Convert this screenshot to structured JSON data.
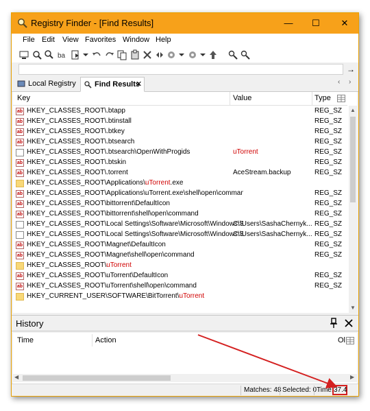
{
  "window": {
    "title": "Registry Finder - [Find Results]",
    "buttons": {
      "minimize": "—",
      "maximize": "☐",
      "close": "✕"
    }
  },
  "menu": [
    "File",
    "Edit",
    "View",
    "Favorites",
    "Window",
    "Help"
  ],
  "tabs": [
    {
      "label": "Local Registry",
      "active": false
    },
    {
      "label": "Find Results",
      "active": true,
      "close": "✕"
    }
  ],
  "results": {
    "columns": {
      "key": "Key",
      "value": "Value",
      "type": "Type"
    },
    "rows": [
      {
        "icon": "ab",
        "key": "HKEY_CLASSES_ROOT\\.btapp",
        "key_hl": "",
        "value": "",
        "value_hl": "",
        "type": "REG_SZ"
      },
      {
        "icon": "ab",
        "key": "HKEY_CLASSES_ROOT\\.btinstall",
        "key_hl": "",
        "value": "",
        "value_hl": "",
        "type": "REG_SZ"
      },
      {
        "icon": "ab",
        "key": "HKEY_CLASSES_ROOT\\.btkey",
        "key_hl": "",
        "value": "",
        "value_hl": "",
        "type": "REG_SZ"
      },
      {
        "icon": "ab",
        "key": "HKEY_CLASSES_ROOT\\.btsearch",
        "key_hl": "",
        "value": "",
        "value_hl": "",
        "type": "REG_SZ"
      },
      {
        "icon": "doc",
        "key": "HKEY_CLASSES_ROOT\\.btsearch\\OpenWithProgids",
        "key_hl": "",
        "value": "",
        "value_hl": "uTorrent",
        "type": "REG_SZ"
      },
      {
        "icon": "ab",
        "key": "HKEY_CLASSES_ROOT\\.btskin",
        "key_hl": "",
        "value": "",
        "value_hl": "",
        "type": "REG_SZ"
      },
      {
        "icon": "ab",
        "key": "HKEY_CLASSES_ROOT\\.torrent",
        "key_hl": "",
        "value": "AceStream.backup",
        "value_hl": "",
        "type": "REG_SZ"
      },
      {
        "icon": "folder",
        "key": "HKEY_CLASSES_ROOT\\Applications\\",
        "key_hl": "uTorrent",
        "key_tail": ".exe",
        "value": "",
        "value_hl": "",
        "type": ""
      },
      {
        "icon": "ab",
        "key": "HKEY_CLASSES_ROOT\\Applications\\uTorrent.exe\\shell\\open\\command...",
        "key_hl": "",
        "value": "",
        "value_hl": "",
        "type": "REG_SZ"
      },
      {
        "icon": "ab",
        "key": "HKEY_CLASSES_ROOT\\bittorrent\\DefaultIcon",
        "key_hl": "",
        "value": "",
        "value_hl": "",
        "type": "REG_SZ"
      },
      {
        "icon": "ab",
        "key": "HKEY_CLASSES_ROOT\\bittorrent\\shell\\open\\command",
        "key_hl": "",
        "value": "",
        "value_hl": "",
        "type": "REG_SZ"
      },
      {
        "icon": "doc",
        "key": "HKEY_CLASSES_ROOT\\Local Settings\\Software\\Microsoft\\Windows\\S...",
        "key_hl": "",
        "value": "C:\\Users\\SashaChernyk...",
        "value_hl": "",
        "type": "REG_SZ"
      },
      {
        "icon": "doc",
        "key": "HKEY_CLASSES_ROOT\\Local Settings\\Software\\Microsoft\\Windows\\S...",
        "key_hl": "",
        "value": "C:\\Users\\SashaChernyk...",
        "value_hl": "",
        "type": "REG_SZ"
      },
      {
        "icon": "ab",
        "key": "HKEY_CLASSES_ROOT\\Magnet\\DefaultIcon",
        "key_hl": "",
        "value": "",
        "value_hl": "",
        "type": "REG_SZ"
      },
      {
        "icon": "ab",
        "key": "HKEY_CLASSES_ROOT\\Magnet\\shell\\open\\command",
        "key_hl": "",
        "value": "",
        "value_hl": "",
        "type": "REG_SZ"
      },
      {
        "icon": "folder",
        "key": "HKEY_CLASSES_ROOT\\",
        "key_hl": "uTorrent",
        "key_tail": "",
        "value": "",
        "value_hl": "",
        "type": ""
      },
      {
        "icon": "ab",
        "key": "HKEY_CLASSES_ROOT\\uTorrent\\DefaultIcon",
        "key_hl": "",
        "value": "",
        "value_hl": "",
        "type": "REG_SZ"
      },
      {
        "icon": "ab",
        "key": "HKEY_CLASSES_ROOT\\uTorrent\\shell\\open\\command",
        "key_hl": "",
        "value": "",
        "value_hl": "",
        "type": "REG_SZ"
      },
      {
        "icon": "folder",
        "key": "HKEY_CURRENT_USER\\SOFTWARE\\BitTorrent\\",
        "key_hl": "uTorrent",
        "key_tail": "",
        "value": "",
        "value_hl": "",
        "type": ""
      }
    ]
  },
  "history": {
    "title": "History",
    "columns": {
      "time": "Time",
      "action": "Action",
      "ol": "Ol"
    }
  },
  "status": {
    "matches": "Matches: 48",
    "selected": "Selected: 0",
    "time_label": "Time:",
    "time_value": "37.4"
  },
  "colors": {
    "titlebar": "#f7a11a",
    "highlight": "#d00000",
    "annotation": "#d42020"
  }
}
